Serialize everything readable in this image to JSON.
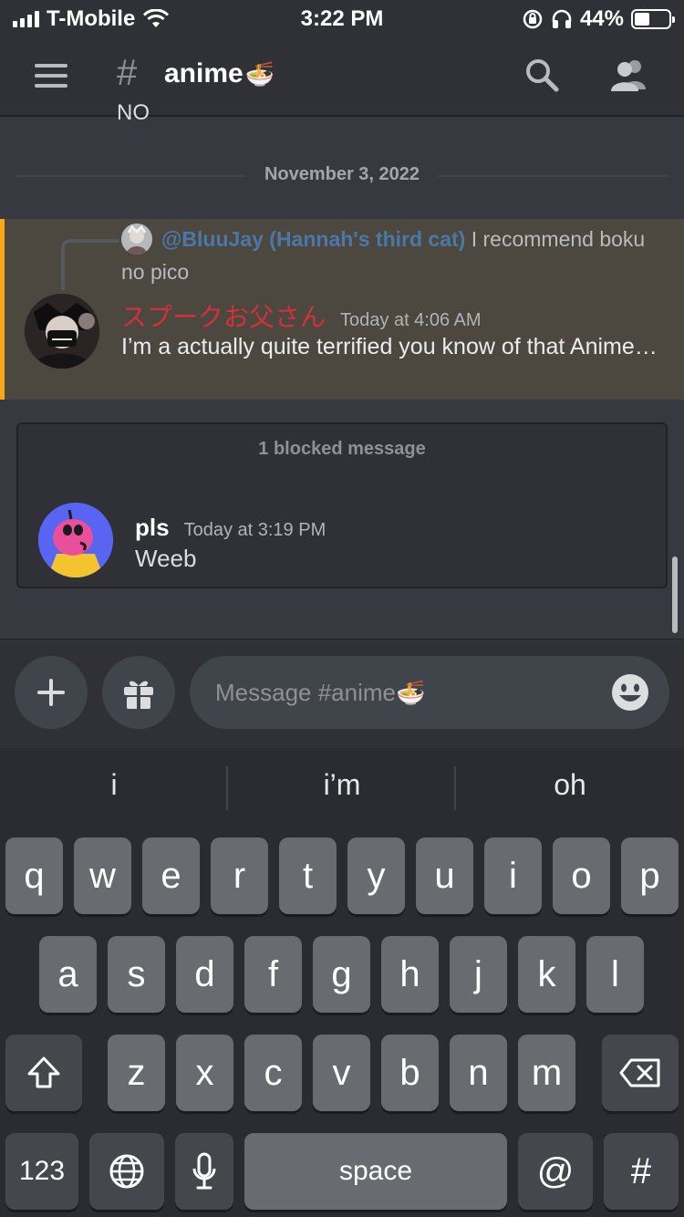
{
  "status_bar": {
    "carrier": "T-Mobile",
    "time": "3:22 PM",
    "battery_percent": "44%",
    "battery_level": 0.44
  },
  "header": {
    "hash": "#",
    "channel_name": "anime",
    "channel_emoji": "🍜",
    "icons": [
      "menu-icon",
      "search-icon",
      "members-icon"
    ]
  },
  "messages": {
    "cut_off_text": "NO",
    "date_divider": "November 3, 2022",
    "mention_message": {
      "reply_mention": "@BluuJay (Hannah's third cat)",
      "reply_text": " I recommend boku no pico",
      "author": "スプークお父さん",
      "timestamp": "Today at 4:06 AM",
      "body": "I’m a actually quite terrified you know of that Anime…",
      "highlight_color": "#faa61a"
    },
    "blocked": {
      "label": "1 blocked message",
      "author": "pls",
      "timestamp": "Today at 3:19 PM",
      "body": "Weeb"
    }
  },
  "composer": {
    "placeholder": "Message #anime🍜",
    "icons": [
      "plus-icon",
      "gift-icon",
      "emoji-icon"
    ]
  },
  "keyboard": {
    "suggestions": [
      "i",
      "i’m",
      "oh"
    ],
    "row1": [
      "q",
      "w",
      "e",
      "r",
      "t",
      "y",
      "u",
      "i",
      "o",
      "p"
    ],
    "row2": [
      "a",
      "s",
      "d",
      "f",
      "g",
      "h",
      "j",
      "k",
      "l"
    ],
    "row3": [
      "z",
      "x",
      "c",
      "v",
      "b",
      "n",
      "m"
    ],
    "numbers_key": "123",
    "space_key": "space",
    "at_key": "@",
    "hash_key": "#"
  }
}
